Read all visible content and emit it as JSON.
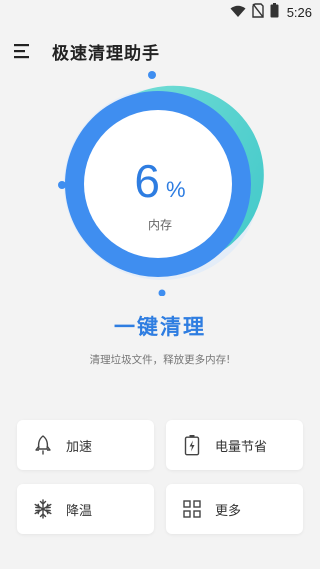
{
  "status_bar": {
    "time": "5:26",
    "icons": [
      "wifi-icon",
      "no-sim-icon",
      "battery-icon"
    ]
  },
  "app_bar": {
    "title": "极速清理助手",
    "menu_icon": "menu-icon"
  },
  "memory": {
    "value": "6",
    "unit": "%",
    "label": "内存",
    "usage_percent": 6
  },
  "clean": {
    "button_label": "一键清理",
    "description": "清理垃圾文件，释放更多内存!"
  },
  "features": [
    {
      "label": "加速",
      "icon": "rocket-icon"
    },
    {
      "label": "电量节省",
      "icon": "battery-saver-icon"
    },
    {
      "label": "降温",
      "icon": "snowflake-icon"
    },
    {
      "label": "更多",
      "icon": "grid-icon"
    }
  ],
  "colors": {
    "accent": "#3f8ef0",
    "ring_secondary": "#5ad6d0",
    "background": "#f3f3f3"
  }
}
